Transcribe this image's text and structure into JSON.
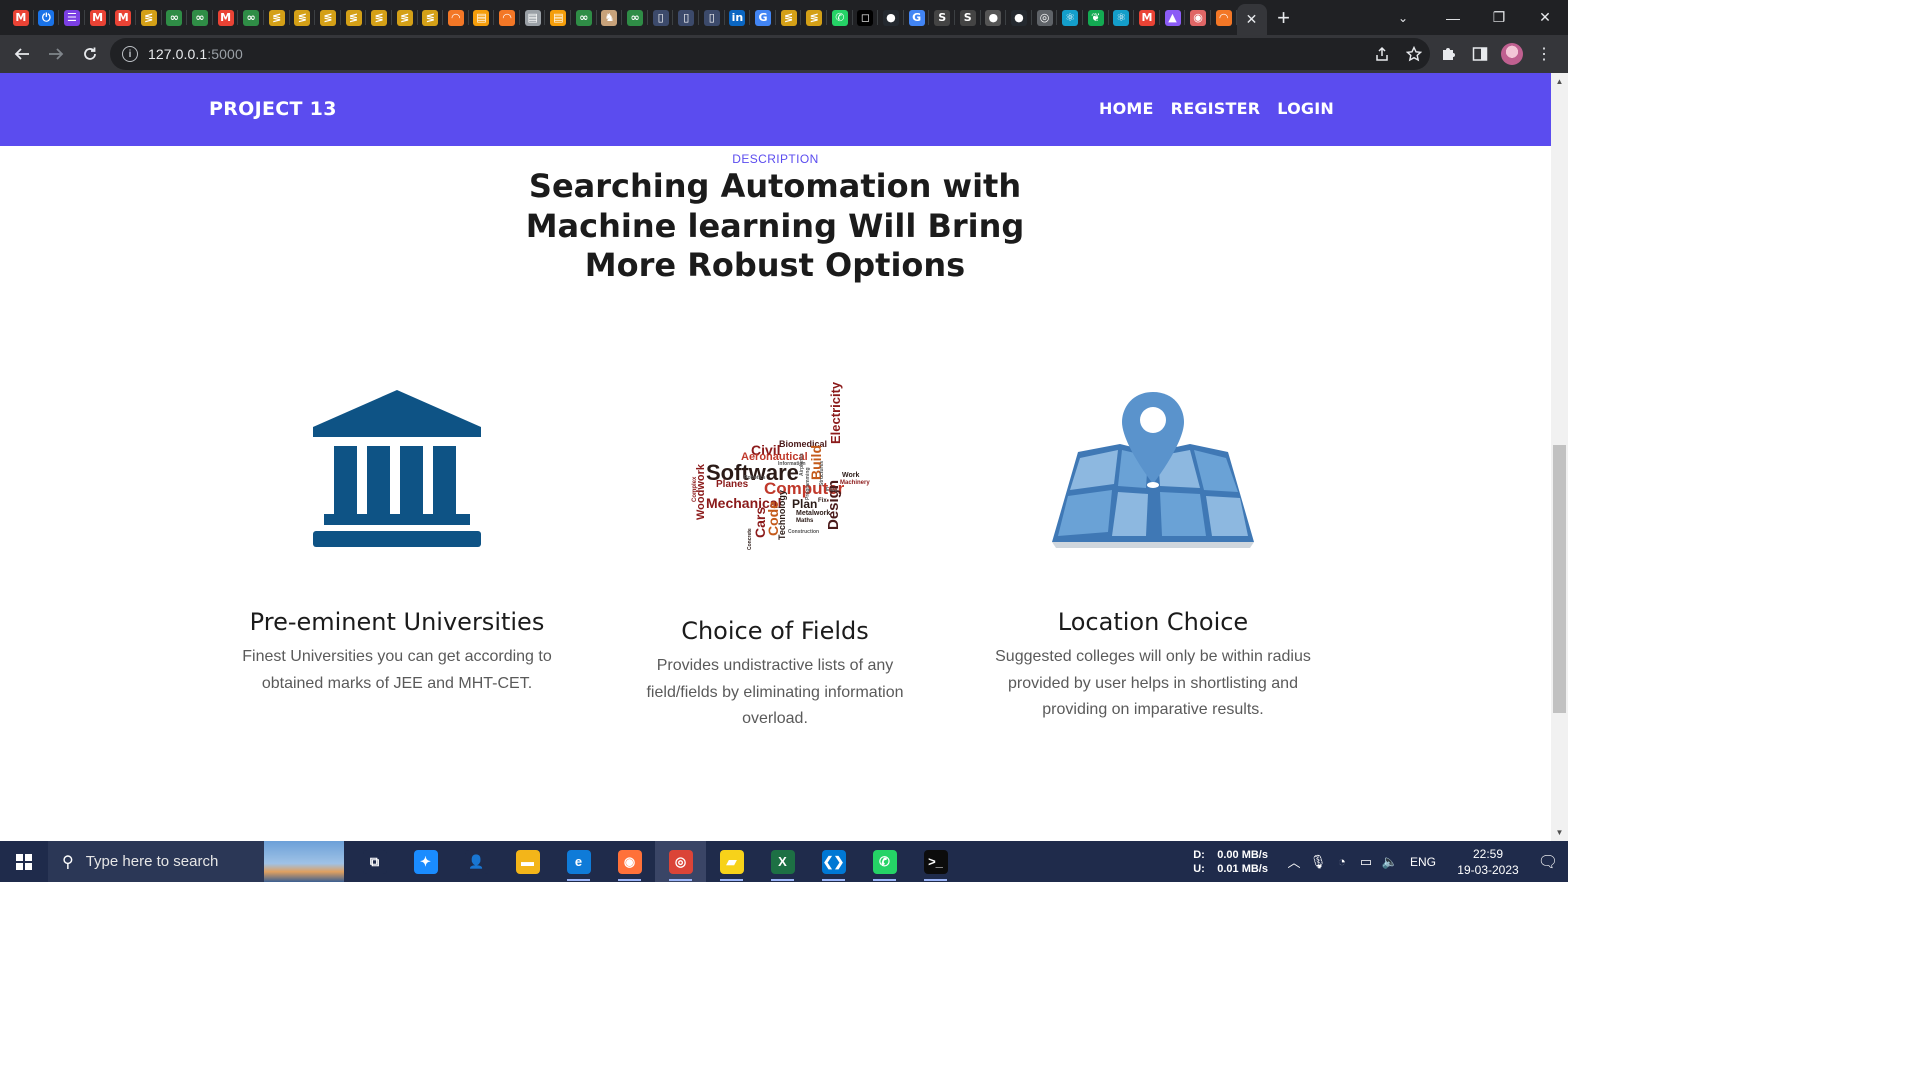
{
  "browser": {
    "tab_favicons": [
      {
        "icon": "gmail-icon",
        "glyph": "M",
        "color": "#ea4335"
      },
      {
        "icon": "power-icon",
        "glyph": "⏻",
        "color": "#1a73e8"
      },
      {
        "icon": "list-icon",
        "glyph": "☰",
        "color": "#7b3fe4"
      },
      {
        "icon": "gmail-icon",
        "glyph": "M",
        "color": "#ea4335"
      },
      {
        "icon": "gmail-icon",
        "glyph": "M",
        "color": "#ea4335"
      },
      {
        "icon": "codechef-icon",
        "glyph": "≶",
        "color": "#d4a017"
      },
      {
        "icon": "geeksforgeeks-icon",
        "glyph": "∞",
        "color": "#2f8d46"
      },
      {
        "icon": "geeksforgeeks-icon",
        "glyph": "∞",
        "color": "#2f8d46"
      },
      {
        "icon": "gmail-icon",
        "glyph": "M",
        "color": "#ea4335"
      },
      {
        "icon": "geeksforgeeks-icon",
        "glyph": "∞",
        "color": "#2f8d46"
      },
      {
        "icon": "codechef-icon",
        "glyph": "≶",
        "color": "#d4a017"
      },
      {
        "icon": "codechef-icon",
        "glyph": "≶",
        "color": "#d4a017"
      },
      {
        "icon": "codechef-icon",
        "glyph": "≶",
        "color": "#d4a017"
      },
      {
        "icon": "codechef-icon",
        "glyph": "≶",
        "color": "#d4a017"
      },
      {
        "icon": "codechef-icon",
        "glyph": "≶",
        "color": "#d4a017"
      },
      {
        "icon": "codechef-icon",
        "glyph": "≶",
        "color": "#d4a017"
      },
      {
        "icon": "codechef-icon",
        "glyph": "≶",
        "color": "#d4a017"
      },
      {
        "icon": "jupyter-icon",
        "glyph": "◠",
        "color": "#f37726"
      },
      {
        "icon": "notebook-icon",
        "glyph": "▤",
        "color": "#f59e0b"
      },
      {
        "icon": "jupyter-icon",
        "glyph": "◠",
        "color": "#f37726"
      },
      {
        "icon": "notebook-icon",
        "glyph": "▤",
        "color": "#9aa0a6"
      },
      {
        "icon": "notebook-icon",
        "glyph": "▤",
        "color": "#f59e0b"
      },
      {
        "icon": "geeksforgeeks-icon",
        "glyph": "∞",
        "color": "#2f8d46"
      },
      {
        "icon": "lion-icon",
        "glyph": "♞",
        "color": "#c8a27a"
      },
      {
        "icon": "geeksforgeeks-icon",
        "glyph": "∞",
        "color": "#2f8d46"
      },
      {
        "icon": "blank-page-icon",
        "glyph": "▯",
        "color": "#3c4a6b"
      },
      {
        "icon": "blank-page-icon",
        "glyph": "▯",
        "color": "#3c4a6b"
      },
      {
        "icon": "blank-page-icon",
        "glyph": "▯",
        "color": "#3c4a6b"
      },
      {
        "icon": "linkedin-icon",
        "glyph": "in",
        "color": "#0a66c2"
      },
      {
        "icon": "google-icon",
        "glyph": "G",
        "color": "#4285f4"
      },
      {
        "icon": "codechef-icon",
        "glyph": "≶",
        "color": "#d4a017"
      },
      {
        "icon": "codechef-icon",
        "glyph": "≶",
        "color": "#d4a017"
      },
      {
        "icon": "whatsapp-icon",
        "glyph": "✆",
        "color": "#25d366"
      },
      {
        "icon": "square-icon",
        "glyph": "◻",
        "color": "#000000"
      },
      {
        "icon": "github-icon",
        "glyph": "●",
        "color": "#24292f"
      },
      {
        "icon": "google-icon",
        "glyph": "G",
        "color": "#4285f4"
      },
      {
        "icon": "stackedit-icon",
        "glyph": "S",
        "color": "#444444"
      },
      {
        "icon": "stackedit-icon",
        "glyph": "S",
        "color": "#444444"
      },
      {
        "icon": "github-icon",
        "glyph": "●",
        "color": "#555555"
      },
      {
        "icon": "github-icon",
        "glyph": "●",
        "color": "#24292f"
      },
      {
        "icon": "chrome-icon",
        "glyph": "◎",
        "color": "#5f6368"
      },
      {
        "icon": "react-icon",
        "glyph": "⚛",
        "color": "#149eca"
      },
      {
        "icon": "mongodb-icon",
        "glyph": "❦",
        "color": "#13aa52"
      },
      {
        "icon": "react-icon",
        "glyph": "⚛",
        "color": "#149eca"
      },
      {
        "icon": "gmail-icon",
        "glyph": "M",
        "color": "#ea4335"
      },
      {
        "icon": "vite-icon",
        "glyph": "▲",
        "color": "#8b5cf6"
      },
      {
        "icon": "record-icon",
        "glyph": "◉",
        "color": "#e06666"
      },
      {
        "icon": "jupyter-icon",
        "glyph": "◠",
        "color": "#f37726"
      }
    ],
    "active_tab_close": "✕",
    "new_tab": "+",
    "window_controls": [
      "—",
      "❐",
      "✕"
    ],
    "tab_search": "⌄",
    "url_host": "127.0.0.1",
    "url_port": ":5000"
  },
  "site": {
    "brand": "PROJECT 13",
    "nav": [
      "HOME",
      "REGISTER",
      "LOGIN"
    ],
    "accent_color": "#5b4cef",
    "section_label": "DESCRIPTION",
    "section_title": "Searching Automation with Machine learning Will Bring More Robust Options",
    "features": [
      {
        "icon": "university-building-icon",
        "title": "Pre-eminent Universities",
        "text": "Finest Universities you can get according to obtained marks of JEE and MHT-CET."
      },
      {
        "icon": "fields-word-cloud-image",
        "title": "Choice of Fields",
        "text": "Provides undistractive lists of any field/fields by eliminating information overload."
      },
      {
        "icon": "map-location-pin-icon",
        "title": "Location Choice",
        "text": "Suggested colleges will only be within radius provided by user helps in shortlisting and providing on imparative results."
      }
    ],
    "word_cloud": [
      "Civil",
      "Biomedical",
      "Aeronautical",
      "Software",
      "Computer",
      "Electricity",
      "Build",
      "Planes",
      "Mechanical",
      "Plan",
      "Woodwork",
      "Cars",
      "Code",
      "Technology",
      "Design",
      "Work",
      "Machinery",
      "Metalwork",
      "Maths",
      "Complex",
      "Concrete",
      "Airplanes",
      "Structures",
      "Information",
      "Fix",
      "Easy",
      "Robotics",
      "Programming",
      "Construction"
    ]
  },
  "taskbar": {
    "search_placeholder": "Type here to search",
    "apps": [
      {
        "icon": "task-view-icon",
        "glyph": "⧉",
        "color": "#1f2b4b"
      },
      {
        "icon": "safari-compass-icon",
        "glyph": "✦",
        "color": "#1a8cff"
      },
      {
        "icon": "user-folder-icon",
        "glyph": "👤",
        "color": "#1f2b4b"
      },
      {
        "icon": "file-explorer-icon",
        "glyph": "▬",
        "color": "#f3b519"
      },
      {
        "icon": "edge-icon",
        "glyph": "e",
        "color": "#0f7bd8"
      },
      {
        "icon": "firefox-icon",
        "glyph": "◉",
        "color": "#ff7139"
      },
      {
        "icon": "chrome-icon",
        "glyph": "◎",
        "color": "#db4437"
      },
      {
        "icon": "sticky-notes-icon",
        "glyph": "▰",
        "color": "#f7d21a"
      },
      {
        "icon": "excel-icon",
        "glyph": "X",
        "color": "#1d7044"
      },
      {
        "icon": "vscode-icon",
        "glyph": "❮❯",
        "color": "#0078d4"
      },
      {
        "icon": "whatsapp-icon",
        "glyph": "✆",
        "color": "#25d366"
      },
      {
        "icon": "terminal-icon",
        "glyph": ">_",
        "color": "#0c0c0c"
      }
    ],
    "net_down_label": "D:",
    "net_down": "0.00 MB/s",
    "net_up_label": "U:",
    "net_up": "0.01 MB/s",
    "language": "ENG",
    "time": "22:59",
    "date": "19-03-2023"
  }
}
